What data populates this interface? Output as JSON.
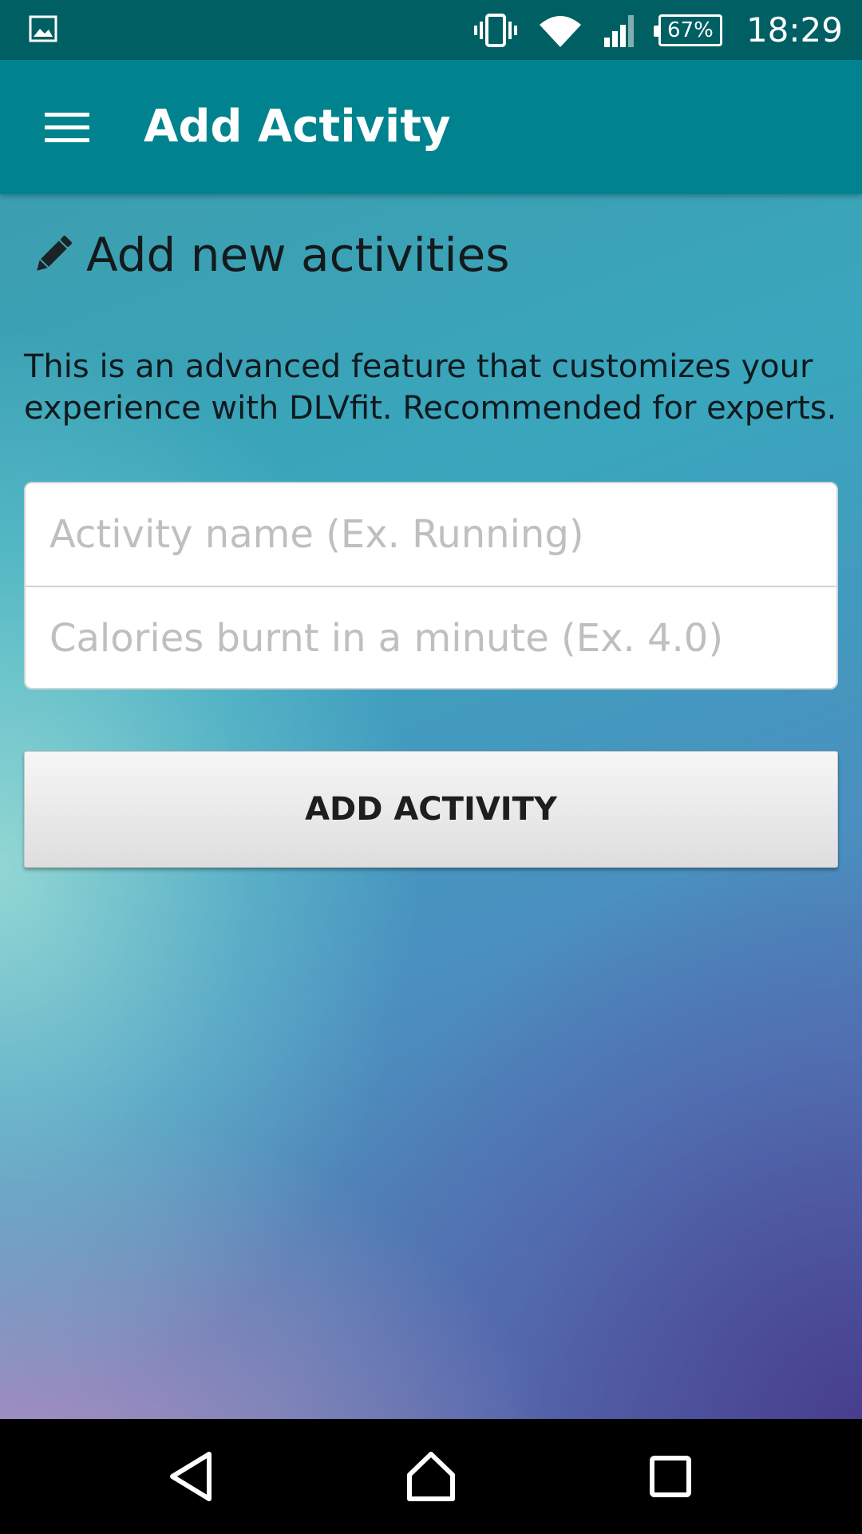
{
  "status_bar": {
    "battery": "67%",
    "time": "18:29",
    "icons": [
      "image-icon",
      "vibrate-icon",
      "wifi-icon",
      "signal-icon",
      "battery-icon"
    ]
  },
  "app_bar": {
    "title": "Add Activity",
    "menu_icon": "hamburger-menu-icon"
  },
  "main": {
    "section_icon": "pencil-icon",
    "section_title": "Add new activities",
    "description": "This is an advanced feature that customizes your experience with DLVfit. Recommended for experts.",
    "activity_name": {
      "placeholder": "Activity name (Ex. Running)",
      "value": ""
    },
    "calories": {
      "placeholder": "Calories burnt in a minute (Ex. 4.0)",
      "value": ""
    },
    "add_button_label": "ADD ACTIVITY"
  },
  "nav_bar": {
    "icons": [
      "back-icon",
      "home-icon",
      "recent-apps-icon"
    ]
  },
  "colors": {
    "status_bar": "#005f63",
    "app_bar": "#00838f",
    "nav_bar": "#000000"
  }
}
